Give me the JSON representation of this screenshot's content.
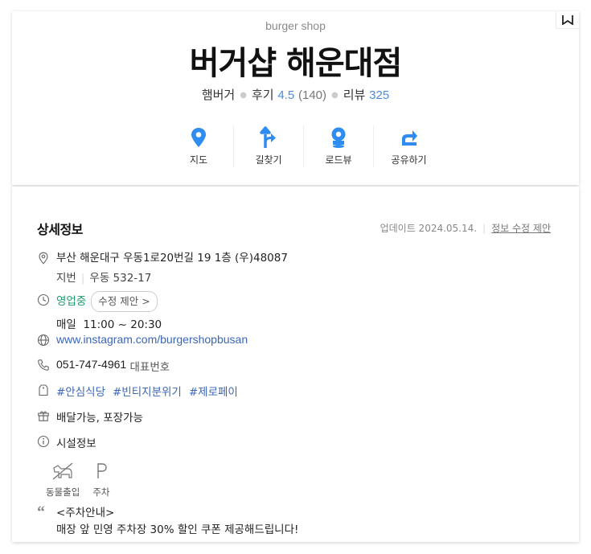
{
  "header": {
    "category": "burger shop",
    "title": "버거샵 해운대점",
    "type": "햄버거",
    "rating_label": "후기",
    "rating": "4.5",
    "rating_count": "(140)",
    "review_label": "리뷰",
    "review_count": "325"
  },
  "actions": [
    {
      "label": "지도",
      "icon": "map-pin-icon"
    },
    {
      "label": "길찾기",
      "icon": "directions-icon"
    },
    {
      "label": "로드뷰",
      "icon": "roadview-icon"
    },
    {
      "label": "공유하기",
      "icon": "share-icon"
    }
  ],
  "details": {
    "title": "상세정보",
    "updated": "업데이트 2024.05.14.",
    "suggest_edit": "정보 수정 제안",
    "address": "부산 해운대구 우동1로20번길 19 1층 (우)48087",
    "lot_label": "지번",
    "lot_value": "우동 532-17",
    "status": "영업중",
    "status_edit": "수정 제안 >",
    "hours_day": "매일",
    "hours_time": "11:00 ~ 20:30",
    "website": "www.instagram.com/burgershopbusan",
    "phone": "051-747-4961",
    "phone_label": "대표번호",
    "tags": [
      "#안심식당",
      "#빈티지분위기",
      "#제로페이"
    ],
    "services": "배달가능, 포장가능",
    "facilities_title": "시설정보",
    "facilities": [
      {
        "label": "동물출입",
        "icon": "no-pets-icon"
      },
      {
        "label": "주차",
        "icon": "parking-icon"
      }
    ],
    "notice_title": "<주차안내>",
    "notice_body": "매장 앞 민영 주차장 30% 할인 쿠폰 제공해드립니다!"
  },
  "colors": {
    "accent": "#2f8cf0",
    "link": "#3a66b8",
    "open": "#1e9c6c"
  }
}
